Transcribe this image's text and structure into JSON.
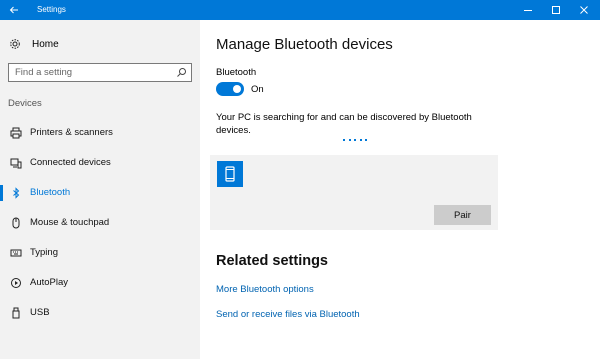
{
  "window": {
    "title": "Settings"
  },
  "sidebar": {
    "home_label": "Home",
    "search_placeholder": "Find a setting",
    "section_label": "Devices",
    "items": [
      {
        "label": "Printers & scanners",
        "icon": "printer-icon",
        "active": false
      },
      {
        "label": "Connected devices",
        "icon": "connected-devices-icon",
        "active": false
      },
      {
        "label": "Bluetooth",
        "icon": "bluetooth-icon",
        "active": true
      },
      {
        "label": "Mouse & touchpad",
        "icon": "mouse-icon",
        "active": false
      },
      {
        "label": "Typing",
        "icon": "keyboard-icon",
        "active": false
      },
      {
        "label": "AutoPlay",
        "icon": "autoplay-icon",
        "active": false
      },
      {
        "label": "USB",
        "icon": "usb-icon",
        "active": false
      }
    ]
  },
  "main": {
    "title": "Manage Bluetooth devices",
    "bluetooth_label": "Bluetooth",
    "toggle_state": "On",
    "status_text": "Your PC is searching for and can be discovered by Bluetooth devices.",
    "device": {
      "icon": "phone-icon",
      "pair_label": "Pair"
    },
    "related_title": "Related settings",
    "links": [
      "More Bluetooth options",
      "Send or receive files via Bluetooth"
    ]
  },
  "colors": {
    "accent": "#0078d7",
    "sidebar_bg": "#f2f2f2",
    "link": "#0063b1",
    "card_bg": "#f2f2f2",
    "button_bg": "#cccccc"
  }
}
